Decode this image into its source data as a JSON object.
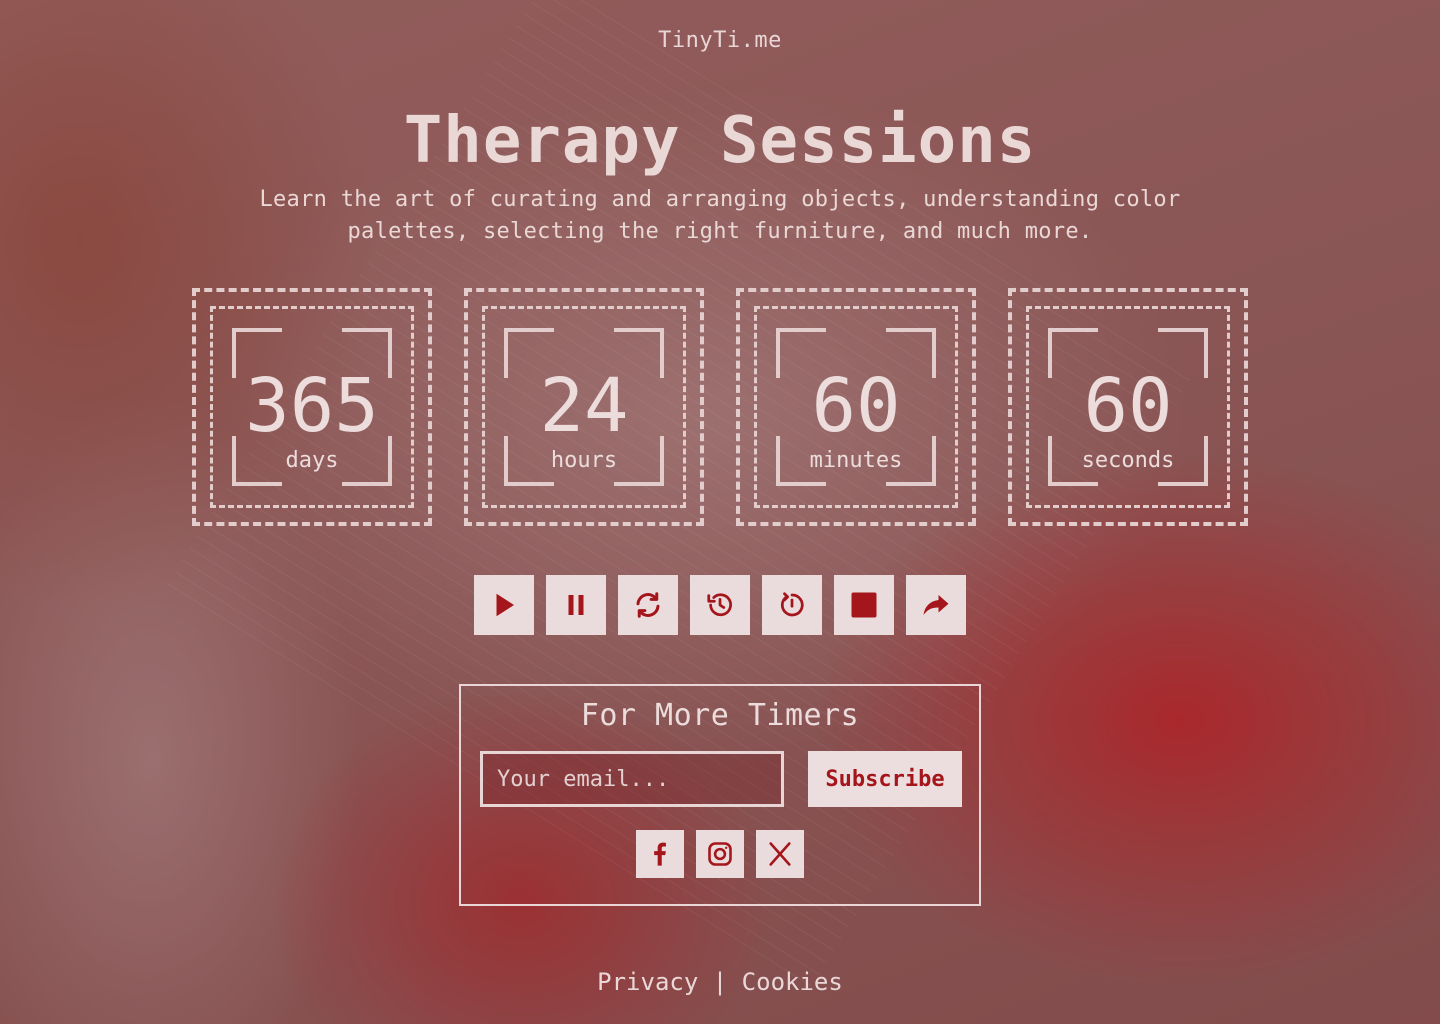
{
  "brand": "TinyTi.me",
  "hero": {
    "title": "Therapy Sessions",
    "subtitle": "Learn the art of curating and arranging objects, understanding color palettes, selecting the right furniture, and much more."
  },
  "countdown": [
    {
      "value": "365",
      "label": "days"
    },
    {
      "value": "24",
      "label": "hours"
    },
    {
      "value": "60",
      "label": "minutes"
    },
    {
      "value": "60",
      "label": "seconds"
    }
  ],
  "controls": [
    {
      "icon": "play-icon"
    },
    {
      "icon": "pause-icon"
    },
    {
      "icon": "restart-icon"
    },
    {
      "icon": "history-icon"
    },
    {
      "icon": "timer-reset-icon"
    },
    {
      "icon": "stop-icon"
    },
    {
      "icon": "share-icon"
    }
  ],
  "subscribe": {
    "heading": "For More Timers",
    "email_placeholder": "Your email...",
    "button_label": "Subscribe",
    "social": [
      "facebook-icon",
      "instagram-icon",
      "x-twitter-icon"
    ]
  },
  "footer": {
    "privacy": "Privacy",
    "separator": "|",
    "cookies": "Cookies"
  },
  "colors": {
    "accent": "#a5161c",
    "foreground": "#ead8d8",
    "button_bg": "#eadcdc"
  }
}
